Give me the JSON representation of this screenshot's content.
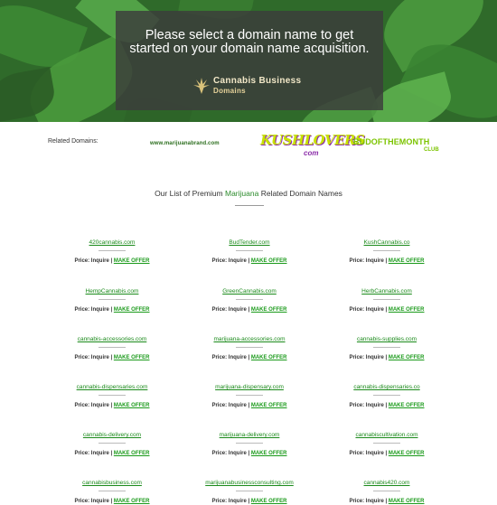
{
  "hero": {
    "headline": "Please select a domain name to get started on your domain name acquisition.",
    "logo_line1": "Cannabis Business",
    "logo_line2": "Domains"
  },
  "related": {
    "label": "Related Domains:",
    "partners": [
      {
        "name": "marijuana-brand.com",
        "text": "www.marijuanabrand.com"
      },
      {
        "name": "kushlovers",
        "text": "KUSHLOVERS",
        "sub": "com"
      },
      {
        "name": "budofthemonth",
        "text": "BUDOFTHEMONTH",
        "sub": "CLUB"
      }
    ]
  },
  "list": {
    "title_pre": "Our List of Premium ",
    "title_hl": "Marijuana",
    "title_post": " Related Domain Names"
  },
  "price_label": "Price: Inquire |",
  "offer_label": "MAKE OFFER",
  "domains": [
    [
      "420cannabis.com",
      "BudTender.com",
      "KushCannabis.co"
    ],
    [
      "HempCannabis.com",
      "GreenCannabis.com",
      "HerbCannabis.com"
    ],
    [
      "cannabis-accessories.com",
      "marijuana-accessories.com",
      "cannabis-supplies.com"
    ],
    [
      "cannabis-dispensaries.com",
      "marijuana-dispensary.com",
      "cannabis-dispensaries.co"
    ],
    [
      "cannabis-delivery.com",
      "marijuana-delivery.com",
      "cannabiscultivation.com"
    ],
    [
      "cannabisbusiness.com",
      "marijuanabusinessconsulting.com",
      "cannabis420.com"
    ]
  ]
}
